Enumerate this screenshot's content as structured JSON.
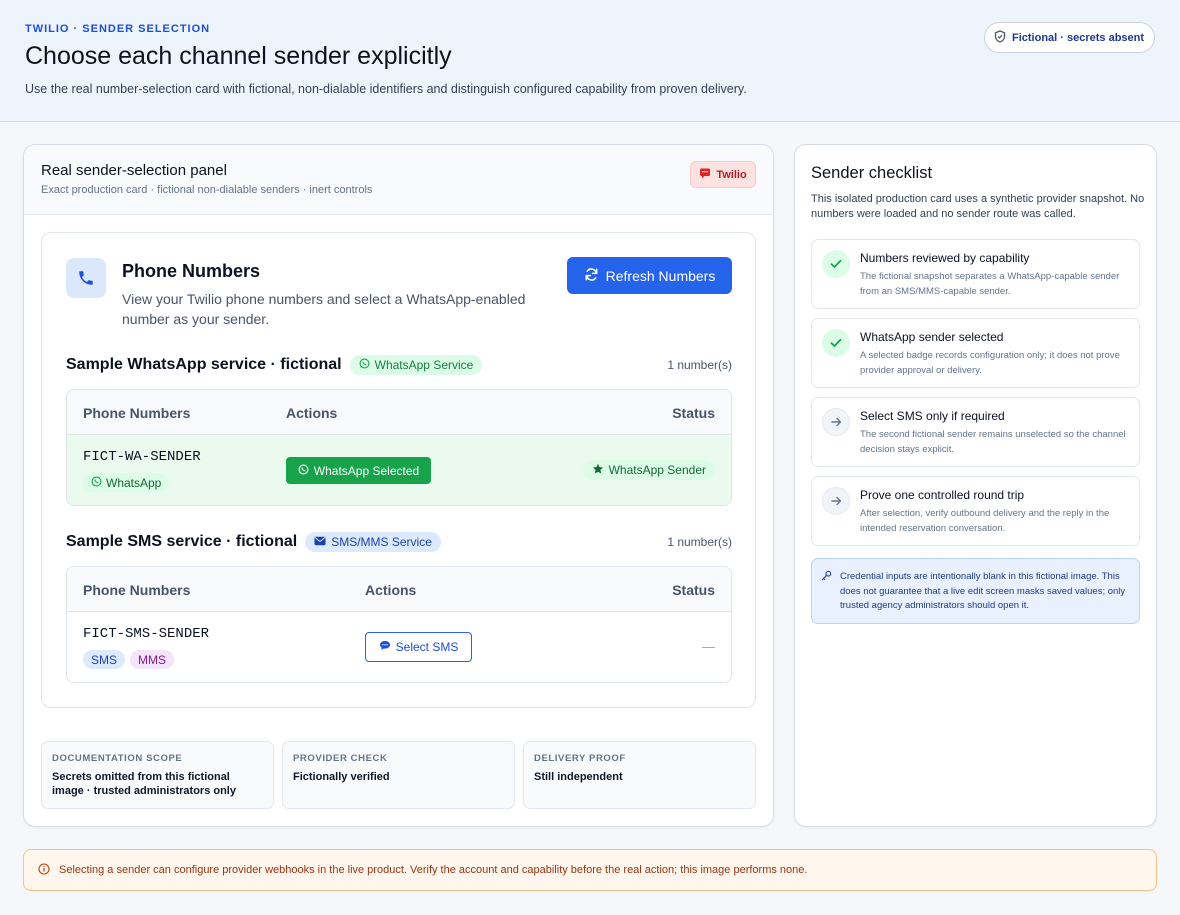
{
  "header": {
    "eyebrow": "TWILIO · SENDER SELECTION",
    "title": "Choose each channel sender explicitly",
    "subtitle": "Use the real number-selection card with fictional, non-dialable identifiers and distinguish configured capability from proven delivery.",
    "badge": "Fictional · secrets absent"
  },
  "panel": {
    "title": "Real sender-selection panel",
    "subtitle": "Exact production card · fictional non-dialable senders · inert controls",
    "provider_badge": "Twilio"
  },
  "phone_numbers": {
    "title": "Phone Numbers",
    "description": "View your Twilio phone numbers and select a WhatsApp-enabled number as your sender.",
    "refresh_label": "Refresh Numbers"
  },
  "services": [
    {
      "name": "Sample WhatsApp service · fictional",
      "pill": "WhatsApp Service",
      "count": "1 number(s)",
      "columns": [
        "Phone Numbers",
        "Actions",
        "Status"
      ],
      "row": {
        "number": "FICT-WA-SENDER",
        "chips": [
          "WhatsApp"
        ],
        "action": "WhatsApp Selected",
        "status": "WhatsApp Sender"
      }
    },
    {
      "name": "Sample SMS service · fictional",
      "pill": "SMS/MMS Service",
      "count": "1 number(s)",
      "columns": [
        "Phone Numbers",
        "Actions",
        "Status"
      ],
      "row": {
        "number": "FICT-SMS-SENDER",
        "chips": [
          "SMS",
          "MMS"
        ],
        "action": "Select SMS",
        "status": "—"
      }
    }
  ],
  "info_boxes": [
    {
      "label": "DOCUMENTATION SCOPE",
      "value": "Secrets omitted from this fictional image · trusted administrators only"
    },
    {
      "label": "PROVIDER CHECK",
      "value": "Fictionally verified"
    },
    {
      "label": "DELIVERY PROOF",
      "value": "Still independent"
    }
  ],
  "checklist": {
    "title": "Sender checklist",
    "description": "This isolated production card uses a synthetic provider snapshot. No numbers were loaded and no sender route was called.",
    "items": [
      {
        "title": "Numbers reviewed by capability",
        "desc": "The fictional snapshot separates a WhatsApp-capable sender from an SMS/MMS-capable sender.",
        "state": "done"
      },
      {
        "title": "WhatsApp sender selected",
        "desc": "A selected badge records configuration only; it does not prove provider approval or delivery.",
        "state": "done"
      },
      {
        "title": "Select SMS only if required",
        "desc": "The second fictional sender remains unselected so the channel decision stays explicit.",
        "state": "todo"
      },
      {
        "title": "Prove one controlled round trip",
        "desc": "After selection, verify outbound delivery and the reply in the intended reservation conversation.",
        "state": "todo"
      }
    ],
    "note": "Credential inputs are intentionally blank in this fictional image. This does not guarantee that a live edit screen masks saved values; only trusted agency administrators should open it."
  },
  "footer_warning": "Selecting a sender can configure provider webhooks in the live product. Verify the account and capability before the real action; this image performs none.",
  "icons": {
    "badge": "shield-icon",
    "provider": "chat-icon",
    "tile": "phone-icon",
    "refresh": "refresh-icon",
    "whatsapp": "whatsapp-icon",
    "sms_service": "envelope-icon",
    "status": "star-icon",
    "select": "chat-bubble-icon",
    "done": "check-icon",
    "todo": "arrow-right-icon",
    "note": "key-icon",
    "warning": "info-circle-icon"
  },
  "colors": {
    "accent": "#2563eb",
    "success": "#16a34a",
    "provider": "#b91c1c",
    "warning": "#9a3412"
  }
}
